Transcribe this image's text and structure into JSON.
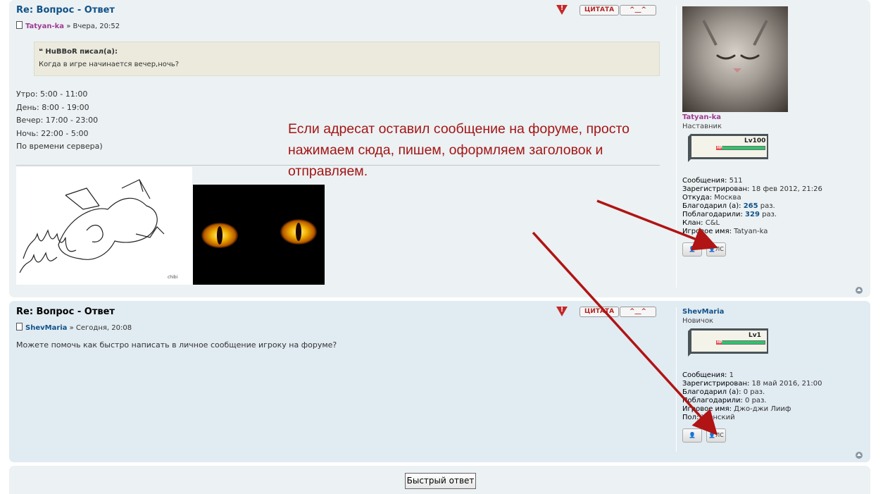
{
  "posts": [
    {
      "title": "Re: Вопрос - Ответ",
      "author": "Tatyan-ka",
      "date": "» Вчера, 20:52",
      "quote_author": "HuBBoR писал(а):",
      "quote_text": "Когда в игре начинается вечер,ночь?",
      "body_lines": [
        "Утро: 5:00 - 11:00",
        "День: 8:00 - 19:00",
        "Вечер: 17:00 - 23:00",
        "Ночь: 22:00 - 5:00",
        "По времени сервера)"
      ],
      "profile": {
        "name": "Tatyan-ka",
        "rank": "Наставник",
        "level": "Lv100",
        "hp_label": "HP",
        "fields": [
          {
            "label": "Сообщения:",
            "value": "511"
          },
          {
            "label": "Зарегистрирован:",
            "value": "18 фев 2012, 21:26"
          },
          {
            "label": "Откуда:",
            "value": "Москва"
          },
          {
            "label": "Благодарил (а):",
            "value": "265",
            "suffix": "раз."
          },
          {
            "label": "Поблагодарили:",
            "value": "329",
            "suffix": "раз."
          },
          {
            "label": "Клан:",
            "value": "C&L"
          },
          {
            "label": "Игровое имя:",
            "value": "Tatyan-ka"
          }
        ]
      }
    },
    {
      "title": "Re: Вопрос - Ответ",
      "author": "ShevMaria",
      "date": "» Сегодня, 20:08",
      "body": "Можете помочь как быстро написать в личное сообщение игроку на форуме?",
      "profile": {
        "name": "ShevMaria",
        "rank": "Новичок",
        "level": "Lv1",
        "hp_label": "HP",
        "fields": [
          {
            "label": "Сообщения:",
            "value": "1"
          },
          {
            "label": "Зарегистрирован:",
            "value": "18 май 2016, 21:00"
          },
          {
            "label": "Благодарил (а):",
            "value": "0 раз."
          },
          {
            "label": "Поблагодарили:",
            "value": "0 раз."
          },
          {
            "label": "Игровое имя:",
            "value": "Джо-джи Лииф"
          },
          {
            "label": "Пол:",
            "value": "Женский"
          }
        ]
      }
    }
  ],
  "buttons": {
    "warn": "!",
    "quote": "ЦИТАТА",
    "thanks": "^__^",
    "pm": "ЛС",
    "quick_reply": "Быстрый ответ"
  },
  "annotation": "Если адресат оставил сообщение на форуме, просто нажимаем сюда, пишем, оформляем заголовок и отправляем.",
  "colors": {
    "annotation": "#a31616",
    "arrow": "#b01414",
    "post_bg_1": "#ecf1f3",
    "post_bg_2": "#e1ebf2",
    "title": "#105289"
  }
}
